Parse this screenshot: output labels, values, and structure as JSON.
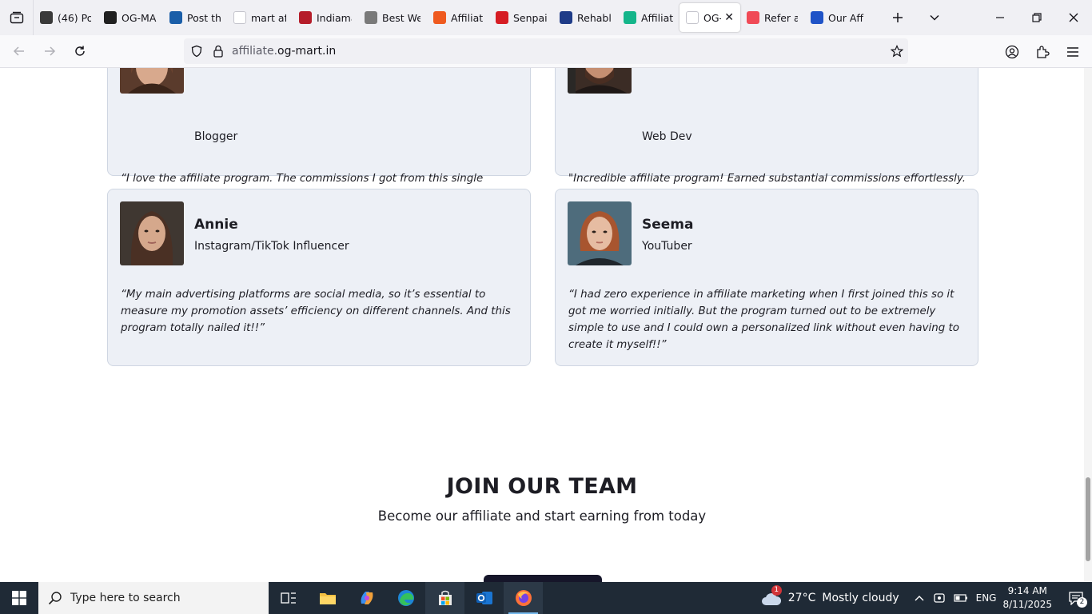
{
  "browser": {
    "tabs": [
      {
        "label": "(46) Po",
        "icon": "quora-icon",
        "color": "#3a3a3a"
      },
      {
        "label": "OG-MA",
        "icon": "chatgpt-icon",
        "color": "#202020"
      },
      {
        "label": "Post th",
        "icon": "xf-icon",
        "color": "#1a5ea8"
      },
      {
        "label": "mart af",
        "icon": "google-icon",
        "color": "#ffffff"
      },
      {
        "label": "Indiama",
        "icon": "indiamart-icon",
        "color": "#b51d2a"
      },
      {
        "label": "Best We",
        "icon": "site-icon",
        "color": "#7a7a7a"
      },
      {
        "label": "Affiliate",
        "icon": "fire-icon",
        "color": "#ef5a1f"
      },
      {
        "label": "Senpai",
        "icon": "opera-icon",
        "color": "#d61d24"
      },
      {
        "label": "Rehabl",
        "icon": "r-icon",
        "color": "#1f3c88"
      },
      {
        "label": "Affiliate",
        "icon": "d-icon",
        "color": "#14b58a"
      },
      {
        "label": "OG-I",
        "icon": "og-icon",
        "color": "#ffffff",
        "active": true
      },
      {
        "label": "Refer a",
        "icon": "refer-icon",
        "color": "#f04a56"
      },
      {
        "label": "Our Aff",
        "icon": "n-icon",
        "color": "#1f53c7"
      }
    ],
    "url_dim": "affiliate.",
    "url_main": "og-mart.in"
  },
  "testimonials": [
    {
      "name": "",
      "role": "Blogger",
      "quote": "“I love the affiliate program. The commissions I got from this single program can cover a whole month’s bill! Earning while you sleep - how great is that?”"
    },
    {
      "name": "",
      "role": "Web Dev",
      "quote": "\"Incredible affiliate program! Earned substantial commissions effortlessly. Outstanding support, timely payments, and an extensive product range to promote. Highly recommend this lucrative opportunity for passive income.\""
    },
    {
      "name": "Annie",
      "role": "Instagram/TikTok Influencer",
      "quote": "“My main advertising platforms are social media, so it’s essential to measure my promotion assets’ efficiency on different channels. And this program totally nailed it!!”"
    },
    {
      "name": "Seema",
      "role": "YouTuber",
      "quote": "“I had zero experience in affiliate marketing when I first joined this so it got me worried initially. But the program turned out to be extremely simple to use and I could own a personalized link without even having to create it myself!!”"
    }
  ],
  "join": {
    "title": "JOIN OUR TEAM",
    "subtitle": "Become our affiliate and start earning from today"
  },
  "taskbar": {
    "search_placeholder": "Type here to search",
    "weather_badge": "1",
    "temperature": "27°C",
    "weather": "Mostly cloudy",
    "language": "ENG",
    "time": "9:14 AM",
    "date": "8/11/2025",
    "notifications": "2"
  }
}
